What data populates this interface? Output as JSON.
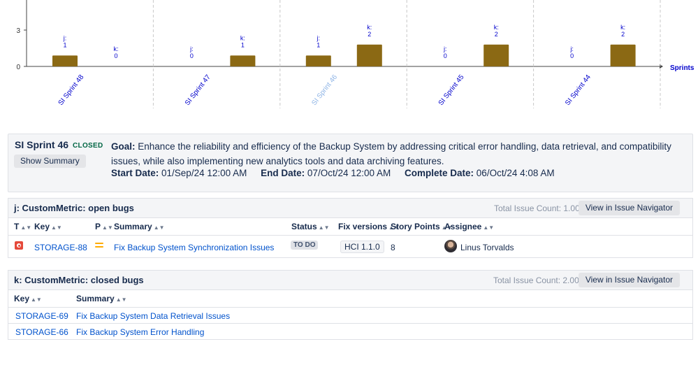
{
  "chart_data": {
    "type": "bar",
    "categories": [
      "SI Sprint 48",
      "SI Sprint 47",
      "SI Sprint 46",
      "SI Sprint 45",
      "SI Sprint 44"
    ],
    "series": [
      {
        "name": "j",
        "values": [
          1,
          0,
          1,
          0,
          0
        ]
      },
      {
        "name": "k",
        "values": [
          0,
          1,
          2,
          2,
          2
        ]
      }
    ],
    "highlighted_category": "SI Sprint 46",
    "ylim": [
      0,
      5
    ],
    "yticks": [
      0,
      3
    ],
    "xlabel": "Sprints",
    "ylabel": "",
    "bar_color": "#8b6914",
    "label_color": "#0000cc",
    "highlight_label_color": "#8eb4e6",
    "grid": "vertical dashed separators"
  },
  "sprint": {
    "name": "SI Sprint 46",
    "status": "CLOSED",
    "show_summary_label": "Show Summary",
    "goal_label": "Goal:",
    "goal_text": "Enhance the reliability and efficiency of the Backup System by addressing critical error handling, data retrieval, and compatibility issues, while also implementing new analytics tools and data archiving features.",
    "start_label": "Start Date:",
    "start_value": "01/Sep/24 12:00 AM",
    "end_label": "End Date:",
    "end_value": "07/Oct/24 12:00 AM",
    "complete_label": "Complete Date:",
    "complete_value": "06/Oct/24 4:08 AM"
  },
  "open_bugs": {
    "title": "j: CustomMetric: open bugs",
    "total_count": "Total Issue Count: 1.00",
    "nav_button": "View in Issue Navigator",
    "columns": [
      "T",
      "Key",
      "P",
      "Summary",
      "Status",
      "Fix versions",
      "Story Points",
      "Assignee"
    ],
    "rows": [
      {
        "type_icon": "bug-icon",
        "key": "STORAGE-88",
        "priority_icon": "medium-priority-icon",
        "summary": "Fix Backup System Synchronization Issues",
        "status": "TO DO",
        "fix_version": "HCI 1.1.0",
        "story_points": "8",
        "assignee": "Linus Torvalds"
      }
    ]
  },
  "closed_bugs": {
    "title": "k: CustomMetric: closed bugs",
    "total_count": "Total Issue Count: 2.00",
    "nav_button": "View in Issue Navigator",
    "columns": [
      "Key",
      "Summary"
    ],
    "rows": [
      {
        "key": "STORAGE-69",
        "summary": "Fix Backup System Data Retrieval Issues"
      },
      {
        "key": "STORAGE-66",
        "summary": "Fix Backup System Error Handling"
      }
    ]
  }
}
